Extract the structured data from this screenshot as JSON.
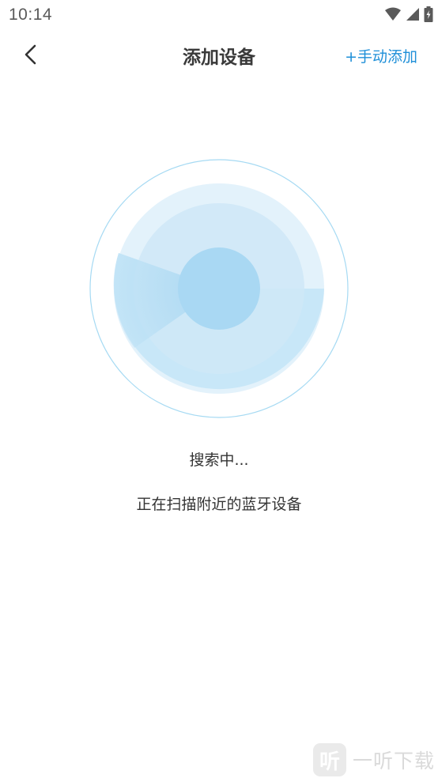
{
  "status_bar": {
    "time": "10:14",
    "icons": [
      "wifi-icon",
      "signal-icon",
      "battery-charging-icon"
    ]
  },
  "header": {
    "back_icon": "chevron-left-icon",
    "title": "添加设备",
    "manual_add_label": "+手动添加"
  },
  "scan": {
    "status_text": "搜索中...",
    "hint_text": "正在扫描附近的蓝牙设备"
  },
  "watermark": {
    "logo_char": "听",
    "text": "一听下载"
  },
  "colors": {
    "accent": "#1e8fd8",
    "radar_ring": "#8fd0f2",
    "radar_fill": "#a9d8f3",
    "radar_core": "#8ecbee",
    "text": "#333333"
  }
}
